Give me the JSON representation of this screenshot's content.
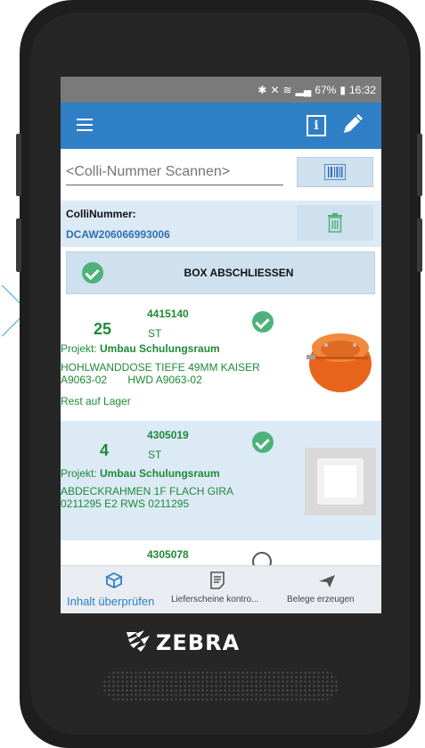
{
  "device": {
    "brand": "ZEBRA"
  },
  "statusbar": {
    "battery": "67%",
    "time": "16:32"
  },
  "scan": {
    "placeholder": "<Colli-Nummer Scannen>"
  },
  "colli": {
    "label": "ColliNummer:",
    "value": "DCAW206066993006"
  },
  "box_button": {
    "label": "BOX ABSCHLIESSEN"
  },
  "items": [
    {
      "artno": "4415140",
      "qty": "25",
      "unit": "ST",
      "project_label": "Projekt: ",
      "project": "Umbau Schulungsraum",
      "desc": "HOHLWANDDOSE TIEFE 49MM KAISER\nA9063-02       HWD A9063-02",
      "stock": "Rest auf Lager",
      "checked": true
    },
    {
      "artno": "4305019",
      "qty": "4",
      "unit": "ST",
      "project_label": "Projekt: ",
      "project": "Umbau Schulungsraum",
      "desc": "ABDECKRAHMEN 1F FLACH GIRA\n0211295 E2 RWS 0211295",
      "stock": "",
      "checked": true
    },
    {
      "artno": "4305078",
      "qty": "",
      "unit": "",
      "checked": false
    }
  ],
  "nav": [
    {
      "label": "Inhalt überprüfen",
      "icon": "box-icon",
      "active": true
    },
    {
      "label": "Lieferscheine kontro...",
      "icon": "document-icon",
      "active": false
    },
    {
      "label": "Belege erzeugen",
      "icon": "send-icon",
      "active": false
    }
  ],
  "colors": {
    "primary": "#2f7fc6",
    "green": "#1f8a36",
    "check": "#4cb27a",
    "panel": "#dceaf6"
  }
}
